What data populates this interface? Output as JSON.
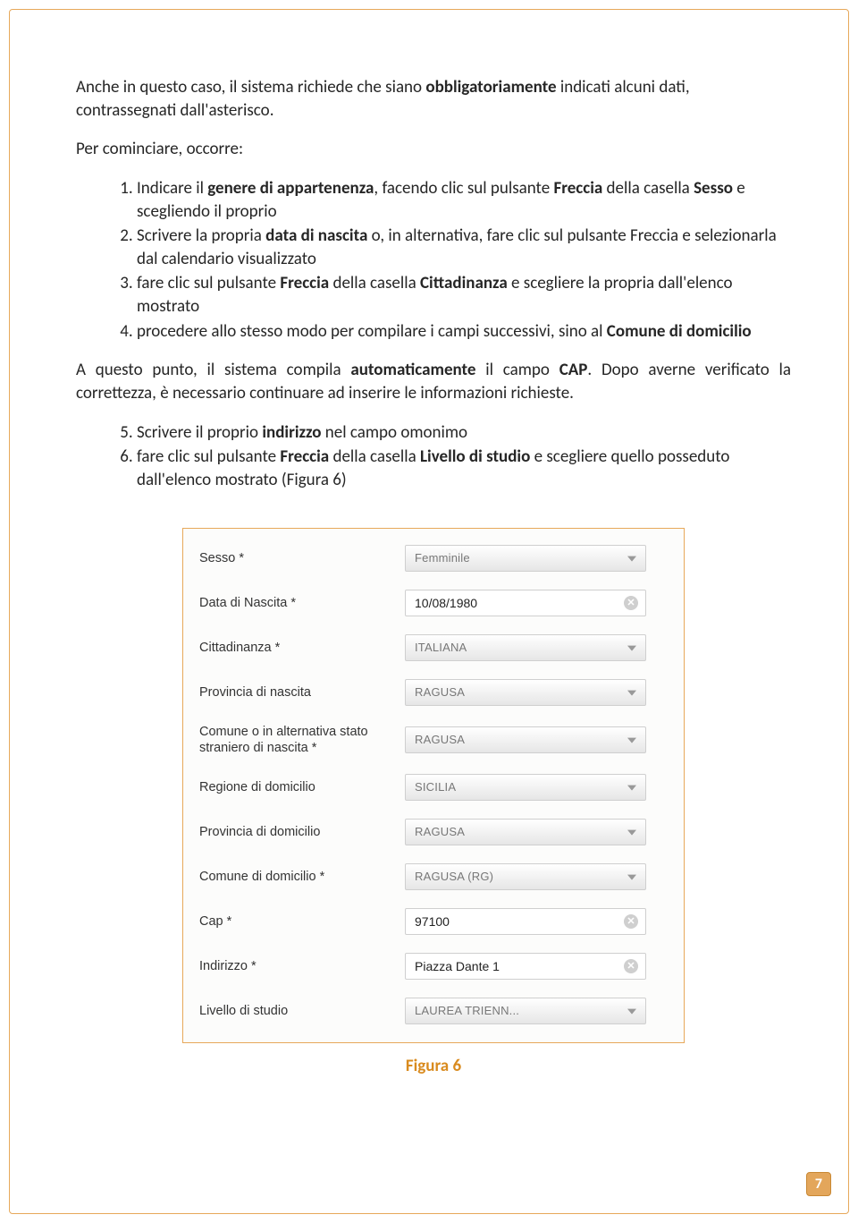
{
  "intro": {
    "p1_prefix": "Anche in questo caso, il sistema richiede che siano ",
    "p1_b1": "obbligatoriamente",
    "p1_suffix": " indicati alcuni dati, contrassegnati dall'asterisco.",
    "p2": "Per cominciare, occorre:"
  },
  "list1": {
    "li1_a": "Indicare il ",
    "li1_b1": "genere di appartenenza",
    "li1_b": ", facendo clic sul pulsante ",
    "li1_b2": "Freccia",
    "li1_c": " della casella ",
    "li1_b3": "Sesso",
    "li1_d": " e scegliendo il proprio",
    "li2_a": "Scrivere la propria ",
    "li2_b1": "data di nascita",
    "li2_b": " o, in alternativa, fare clic sul pulsante Freccia e selezionarla dal calendario visualizzato",
    "li3_a": "fare clic sul pulsante ",
    "li3_b1": "Freccia",
    "li3_b": " della casella ",
    "li3_b2": "Cittadinanza",
    "li3_c": " e scegliere la propria dall'elenco mostrato",
    "li4_a": "procedere allo stesso modo per compilare i campi successivi, sino al ",
    "li4_b1": "Comune di domicilio"
  },
  "mid": {
    "p_a": "A questo punto, il sistema compila ",
    "p_b1": "automaticamente",
    "p_b": " il campo ",
    "p_b2": "CAP",
    "p_c": ". Dopo averne verificato la correttezza, è necessario continuare ad inserire le informazioni richieste."
  },
  "list2": {
    "li5_a": "Scrivere il proprio ",
    "li5_b1": "indirizzo",
    "li5_b": " nel campo omonimo",
    "li6_a": "fare clic sul pulsante ",
    "li6_b1": "Freccia",
    "li6_b": " della casella ",
    "li6_b2": "Livello di studio",
    "li6_c": " e scegliere quello posseduto dall'elenco mostrato (Figura 6)"
  },
  "form": {
    "sesso": {
      "label": "Sesso *",
      "value": "Femminile"
    },
    "data_nascita": {
      "label": "Data di Nascita *",
      "value": "10/08/1980"
    },
    "cittadinanza": {
      "label": "Cittadinanza *",
      "value": "ITALIANA"
    },
    "provincia_nascita": {
      "label": "Provincia di nascita",
      "value": "RAGUSA"
    },
    "comune_nascita": {
      "label": "Comune o in alternativa stato straniero di nascita *",
      "value": "RAGUSA"
    },
    "regione_domicilio": {
      "label": "Regione di domicilio",
      "value": "SICILIA"
    },
    "provincia_domicilio": {
      "label": "Provincia di domicilio",
      "value": "RAGUSA"
    },
    "comune_domicilio": {
      "label": "Comune di domicilio *",
      "value": "RAGUSA (RG)"
    },
    "cap": {
      "label": "Cap *",
      "value": "97100"
    },
    "indirizzo": {
      "label": "Indirizzo *",
      "value": "Piazza Dante 1"
    },
    "livello_studio": {
      "label": "Livello di studio",
      "value": "LAUREA TRIENN..."
    }
  },
  "figure_caption": "Figura 6",
  "page_number": "7"
}
